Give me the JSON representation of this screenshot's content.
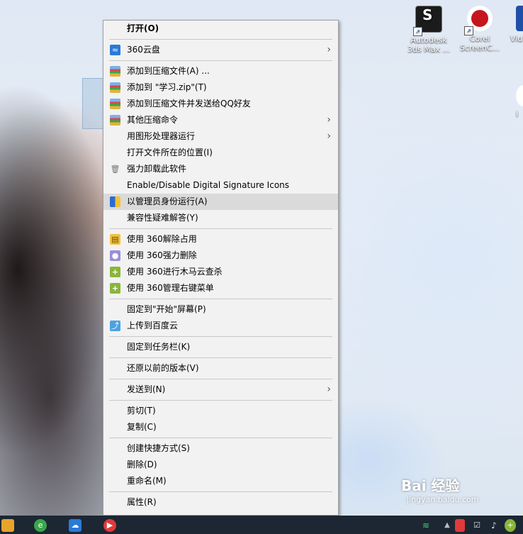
{
  "desktop": {
    "icons": [
      {
        "label_line1": "Autodesk",
        "label_line2": "3ds Max ...",
        "color": "#1b1b1b"
      },
      {
        "label_line1": "Corel",
        "label_line2": "ScreenC...",
        "color": "#c4161c"
      },
      {
        "label_line1": "Vid",
        "label_line2": "",
        "color": "#1f4fa8"
      }
    ],
    "partial_icon_label": "i"
  },
  "context_menu": {
    "items": [
      {
        "label": "打开(O)",
        "bold": true
      },
      {
        "sep": true
      },
      {
        "label": "360云盘",
        "icon": "cloud-icon",
        "submenu": true
      },
      {
        "sep": true
      },
      {
        "label": "添加到压缩文件(A) ...",
        "icon": "winrar-icon"
      },
      {
        "label": "添加到 \"学习.zip\"(T)",
        "icon": "winrar-icon"
      },
      {
        "label": "添加到压缩文件并发送给QQ好友",
        "icon": "winrar-icon"
      },
      {
        "label": "其他压缩命令",
        "icon": "winrar-icon",
        "submenu": true
      },
      {
        "label": "用图形处理器运行",
        "submenu": true
      },
      {
        "label": "打开文件所在的位置(I)"
      },
      {
        "label": "强力卸载此软件",
        "icon": "trash-icon"
      },
      {
        "label": "Enable/Disable Digital Signature Icons"
      },
      {
        "label": "以管理员身份运行(A)",
        "icon": "uac-shield-icon",
        "hover": true
      },
      {
        "label": "兼容性疑难解答(Y)"
      },
      {
        "sep": true
      },
      {
        "label": "使用 360解除占用",
        "icon": "unlock-icon"
      },
      {
        "label": "使用 360强力删除",
        "icon": "shred-icon"
      },
      {
        "label": "使用 360进行木马云查杀",
        "icon": "360-scan-icon"
      },
      {
        "label": "使用 360管理右键菜单",
        "icon": "360-manage-icon"
      },
      {
        "sep": true
      },
      {
        "label": "固定到\"开始\"屏幕(P)"
      },
      {
        "label": "上传到百度云",
        "icon": "baidu-cloud-icon"
      },
      {
        "sep": true
      },
      {
        "label": "固定到任务栏(K)"
      },
      {
        "sep": true
      },
      {
        "label": "还原以前的版本(V)"
      },
      {
        "sep": true
      },
      {
        "label": "发送到(N)",
        "submenu": true
      },
      {
        "sep": true
      },
      {
        "label": "剪切(T)"
      },
      {
        "label": "复制(C)"
      },
      {
        "sep": true
      },
      {
        "label": "创建快捷方式(S)"
      },
      {
        "label": "删除(D)"
      },
      {
        "label": "重命名(M)"
      },
      {
        "sep": true
      },
      {
        "label": "属性(R)"
      }
    ]
  },
  "watermark": {
    "brand": "Bai 经验",
    "url": "jingyan.baidu.com"
  },
  "colors": {
    "menu_bg": "#f2f2f2",
    "hover_bg": "#dadada",
    "taskbar": "#1c2733"
  }
}
